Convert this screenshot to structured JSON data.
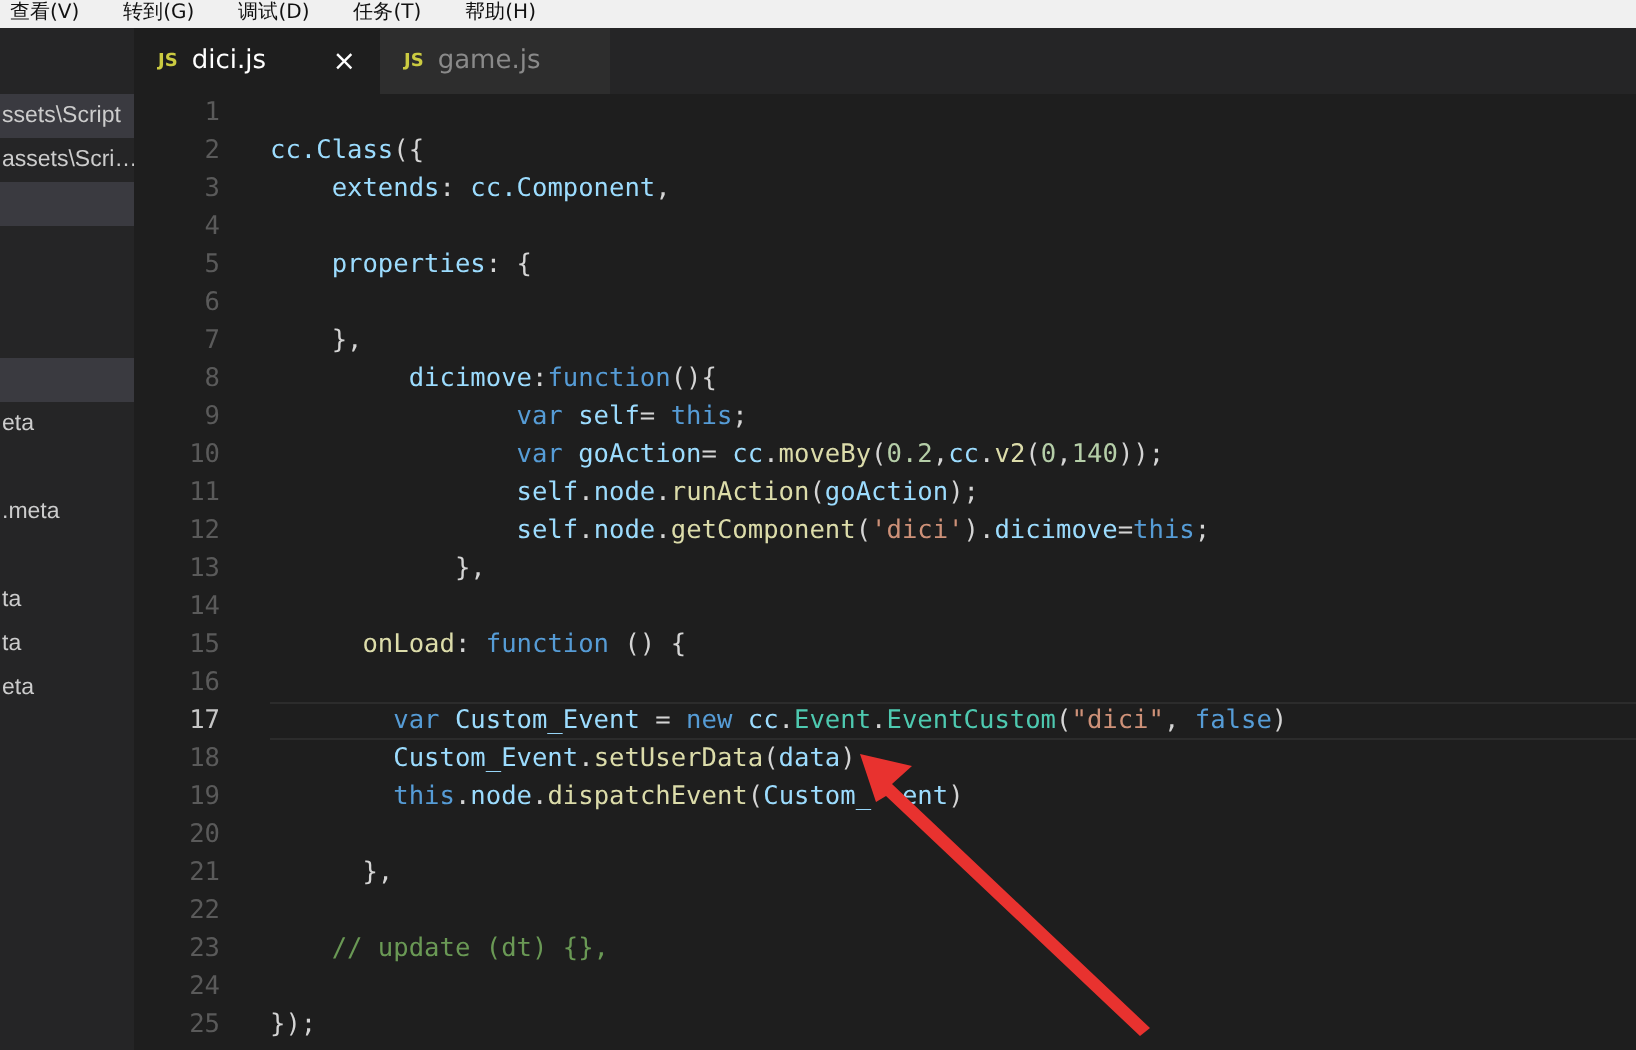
{
  "menu_bar": [
    "查看(V)",
    "转到(G)",
    "调试(D)",
    "任务(T)",
    "帮助(H)"
  ],
  "sidebar": {
    "rows": [
      {
        "label": "ssets\\Script",
        "selected": true
      },
      {
        "label": "assets\\Scri…",
        "selected": false
      },
      {
        "selected": true
      },
      {
        "selected": false
      },
      {
        "selected": false
      },
      {
        "selected": false
      },
      {
        "selected": true
      },
      {
        "label": "eta",
        "selected": false
      },
      {
        "selected": false
      },
      {
        "label": ".meta",
        "selected": false
      },
      {
        "selected": false
      },
      {
        "label": "ta",
        "selected": false
      },
      {
        "label": "ta",
        "selected": false
      },
      {
        "label": "eta",
        "selected": false
      }
    ]
  },
  "tabs": [
    {
      "badge": "JS",
      "label": "dici.js",
      "selected": true,
      "close": "×"
    },
    {
      "badge": "JS",
      "label": "game.js",
      "selected": false
    }
  ],
  "editor": {
    "lines": [
      {
        "number": "1",
        "current": false
      },
      {
        "number": "2",
        "current": false,
        "tokens": [
          {
            "text": "cc.Class",
            "kind": "var"
          },
          {
            "text": "({",
            "kind": "punct"
          }
        ]
      },
      {
        "number": "3",
        "current": false,
        "tokens": [
          {
            "text": "    extends",
            "kind": "var"
          },
          {
            "text": ": ",
            "kind": "punct"
          },
          {
            "text": "cc.Component",
            "kind": "var"
          },
          {
            "text": ",",
            "kind": "punct"
          }
        ]
      },
      {
        "number": "4",
        "current": false
      },
      {
        "number": "5",
        "current": false,
        "tokens": [
          {
            "text": "    properties",
            "kind": "var"
          },
          {
            "text": ": {",
            "kind": "punct"
          }
        ]
      },
      {
        "number": "6",
        "current": false
      },
      {
        "number": "7",
        "current": false,
        "tokens": [
          {
            "text": "    },",
            "kind": "punct"
          }
        ]
      },
      {
        "number": "8",
        "current": false,
        "tokens": [
          {
            "text": "         dicimove",
            "kind": "var"
          },
          {
            "text": ":",
            "kind": "punct"
          },
          {
            "text": "function",
            "kind": "kw"
          },
          {
            "text": "(){",
            "kind": "punct"
          }
        ]
      },
      {
        "number": "9",
        "current": false,
        "tokens": [
          {
            "text": "                var",
            "kind": "kw"
          },
          {
            "text": " self",
            "kind": "var"
          },
          {
            "text": "= ",
            "kind": "punct"
          },
          {
            "text": "this",
            "kind": "kw"
          },
          {
            "text": ";",
            "kind": "punct"
          }
        ]
      },
      {
        "number": "10",
        "current": false,
        "tokens": [
          {
            "text": "                var",
            "kind": "kw"
          },
          {
            "text": " goAction",
            "kind": "var"
          },
          {
            "text": "= ",
            "kind": "punct"
          },
          {
            "text": "cc",
            "kind": "var"
          },
          {
            "text": ".",
            "kind": "punct"
          },
          {
            "text": "moveBy",
            "kind": "fn"
          },
          {
            "text": "(",
            "kind": "punct"
          },
          {
            "text": "0.2",
            "kind": "num"
          },
          {
            "text": ",",
            "kind": "punct"
          },
          {
            "text": "cc",
            "kind": "var"
          },
          {
            "text": ".",
            "kind": "punct"
          },
          {
            "text": "v2",
            "kind": "fn"
          },
          {
            "text": "(",
            "kind": "punct"
          },
          {
            "text": "0",
            "kind": "num"
          },
          {
            "text": ",",
            "kind": "punct"
          },
          {
            "text": "140",
            "kind": "num"
          },
          {
            "text": "));",
            "kind": "punct"
          }
        ]
      },
      {
        "number": "11",
        "current": false,
        "tokens": [
          {
            "text": "                self",
            "kind": "var"
          },
          {
            "text": ".",
            "kind": "punct"
          },
          {
            "text": "node",
            "kind": "var"
          },
          {
            "text": ".",
            "kind": "punct"
          },
          {
            "text": "runAction",
            "kind": "fn"
          },
          {
            "text": "(",
            "kind": "punct"
          },
          {
            "text": "goAction",
            "kind": "var"
          },
          {
            "text": ");",
            "kind": "punct"
          }
        ]
      },
      {
        "number": "12",
        "current": false,
        "tokens": [
          {
            "text": "                self",
            "kind": "var"
          },
          {
            "text": ".",
            "kind": "punct"
          },
          {
            "text": "node",
            "kind": "var"
          },
          {
            "text": ".",
            "kind": "punct"
          },
          {
            "text": "getComponent",
            "kind": "fn"
          },
          {
            "text": "(",
            "kind": "punct"
          },
          {
            "text": "'dici'",
            "kind": "str"
          },
          {
            "text": ").",
            "kind": "punct"
          },
          {
            "text": "dicimove",
            "kind": "var"
          },
          {
            "text": "=",
            "kind": "punct"
          },
          {
            "text": "this",
            "kind": "kw"
          },
          {
            "text": ";",
            "kind": "punct"
          }
        ]
      },
      {
        "number": "13",
        "current": false,
        "tokens": [
          {
            "text": "            },",
            "kind": "punct"
          }
        ]
      },
      {
        "number": "14",
        "current": false
      },
      {
        "number": "15",
        "current": false,
        "tokens": [
          {
            "text": "      onLoad",
            "kind": "fn"
          },
          {
            "text": ": ",
            "kind": "punct"
          },
          {
            "text": "function",
            "kind": "kw"
          },
          {
            "text": " () {",
            "kind": "punct"
          }
        ]
      },
      {
        "number": "16",
        "current": false
      },
      {
        "number": "17",
        "current": true,
        "tokens": [
          {
            "text": "        var",
            "kind": "kw"
          },
          {
            "text": " Custom_Event",
            "kind": "var"
          },
          {
            "text": " = ",
            "kind": "punct"
          },
          {
            "text": "new",
            "kind": "kw"
          },
          {
            "text": " cc",
            "kind": "var"
          },
          {
            "text": ".",
            "kind": "punct"
          },
          {
            "text": "Event",
            "kind": "cls"
          },
          {
            "text": ".",
            "kind": "punct"
          },
          {
            "text": "EventCustom",
            "kind": "cls"
          },
          {
            "text": "(",
            "kind": "punct"
          },
          {
            "text": "\"dici\"",
            "kind": "str"
          },
          {
            "text": ", ",
            "kind": "punct"
          },
          {
            "text": "false",
            "kind": "kw"
          },
          {
            "text": ")",
            "kind": "punct"
          }
        ]
      },
      {
        "number": "18",
        "current": false,
        "tokens": [
          {
            "text": "        Custom_Event",
            "kind": "var"
          },
          {
            "text": ".",
            "kind": "punct"
          },
          {
            "text": "setUserData",
            "kind": "fn"
          },
          {
            "text": "(",
            "kind": "punct"
          },
          {
            "text": "data",
            "kind": "var"
          },
          {
            "text": ")",
            "kind": "punct"
          }
        ]
      },
      {
        "number": "19",
        "current": false,
        "tokens": [
          {
            "text": "        this",
            "kind": "kw"
          },
          {
            "text": ".",
            "kind": "punct"
          },
          {
            "text": "node",
            "kind": "var"
          },
          {
            "text": ".",
            "kind": "punct"
          },
          {
            "text": "dispatchEvent",
            "kind": "fn"
          },
          {
            "text": "(",
            "kind": "punct"
          },
          {
            "text": "Custom_",
            "kind": "var"
          },
          {
            "kind": "covered"
          },
          {
            "text": "ent",
            "kind": "var"
          },
          {
            "text": ")",
            "kind": "punct"
          }
        ]
      },
      {
        "number": "20",
        "current": false
      },
      {
        "number": "21",
        "current": false,
        "tokens": [
          {
            "text": "      },",
            "kind": "punct"
          }
        ]
      },
      {
        "number": "22",
        "current": false
      },
      {
        "number": "23",
        "current": false,
        "tokens": [
          {
            "text": "    // update (dt) {},",
            "kind": "comment"
          }
        ]
      },
      {
        "number": "24",
        "current": false
      },
      {
        "number": "25",
        "current": false,
        "tokens": [
          {
            "text": "});",
            "kind": "punct"
          }
        ]
      }
    ]
  }
}
